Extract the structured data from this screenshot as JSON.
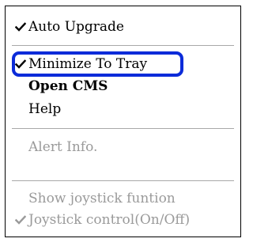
{
  "menu": {
    "items": [
      {
        "label": "Auto Upgrade",
        "checked": true,
        "enabled": true,
        "bold": false
      },
      {
        "label": "Minimize To Tray",
        "checked": true,
        "enabled": true,
        "bold": false,
        "highlighted": true
      },
      {
        "label": "Open CMS",
        "checked": false,
        "enabled": true,
        "bold": true
      },
      {
        "label": "Help",
        "checked": false,
        "enabled": true,
        "bold": false
      },
      {
        "label": "Alert Info.",
        "checked": false,
        "enabled": false,
        "bold": false
      },
      {
        "label": "Show joystick funtion",
        "checked": false,
        "enabled": false,
        "bold": false
      },
      {
        "label": "Joystick control(On/Off)",
        "checked": true,
        "enabled": false,
        "bold": false
      }
    ],
    "icons": {
      "check": "checkmark-icon"
    },
    "colors": {
      "highlight_ring": "#0b2bd9",
      "disabled_text": "#9a9a9a",
      "separator": "#a8a8a8"
    }
  }
}
